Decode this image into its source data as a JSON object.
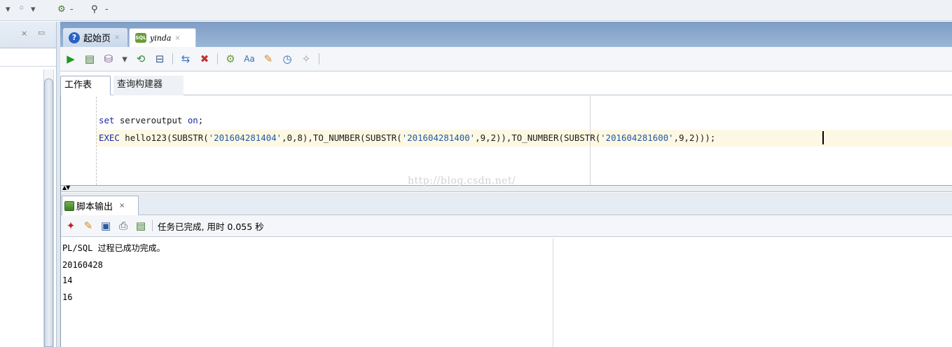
{
  "top_toolbar": {
    "glyphs": [
      "◦",
      "▾",
      "➜",
      "▾",
      "⚙",
      "-",
      "⚲",
      "-"
    ]
  },
  "left_panel": {
    "close_glyph": "×",
    "minimize_glyph": "▭"
  },
  "editor_tabs": [
    {
      "label": "起始页",
      "icon": "help-icon",
      "close": "×"
    },
    {
      "label": "yinda",
      "icon": "sql-connection-icon",
      "close": "×"
    }
  ],
  "worksheet_tabs": {
    "worksheet": "工作表",
    "query_builder": "查询构建器"
  },
  "sql": {
    "line1": {
      "kw1": "set",
      "rest": " serveroutput ",
      "kw2": "on",
      "tail": ";"
    },
    "line2": {
      "kw": "EXEC",
      "p1": " hello123(SUBSTR(",
      "s1": "'201604281404'",
      "p2": ",0,8),TO_NUMBER(SUBSTR(",
      "s2": "'201604281400'",
      "p3": ",9,2)),TO_NUMBER(SUBSTR(",
      "s3": "'201604281600'",
      "p4": ",9,2)));"
    }
  },
  "watermark": "http://blog.csdn.net/",
  "output_panel": {
    "tab_label": "脚本输出",
    "tab_close": "×",
    "status": "任务已完成, 用时 0.055 秒",
    "lines": [
      "PL/SQL 过程已成功完成。",
      "20160428",
      "14",
      "16"
    ]
  },
  "splitter": {
    "arrows": "▲▼"
  },
  "colors": {
    "tab_strip": "#8aa8cf",
    "keyword": "#1d28a8",
    "string": "#2058a8",
    "current_line": "#fdf8e3"
  }
}
